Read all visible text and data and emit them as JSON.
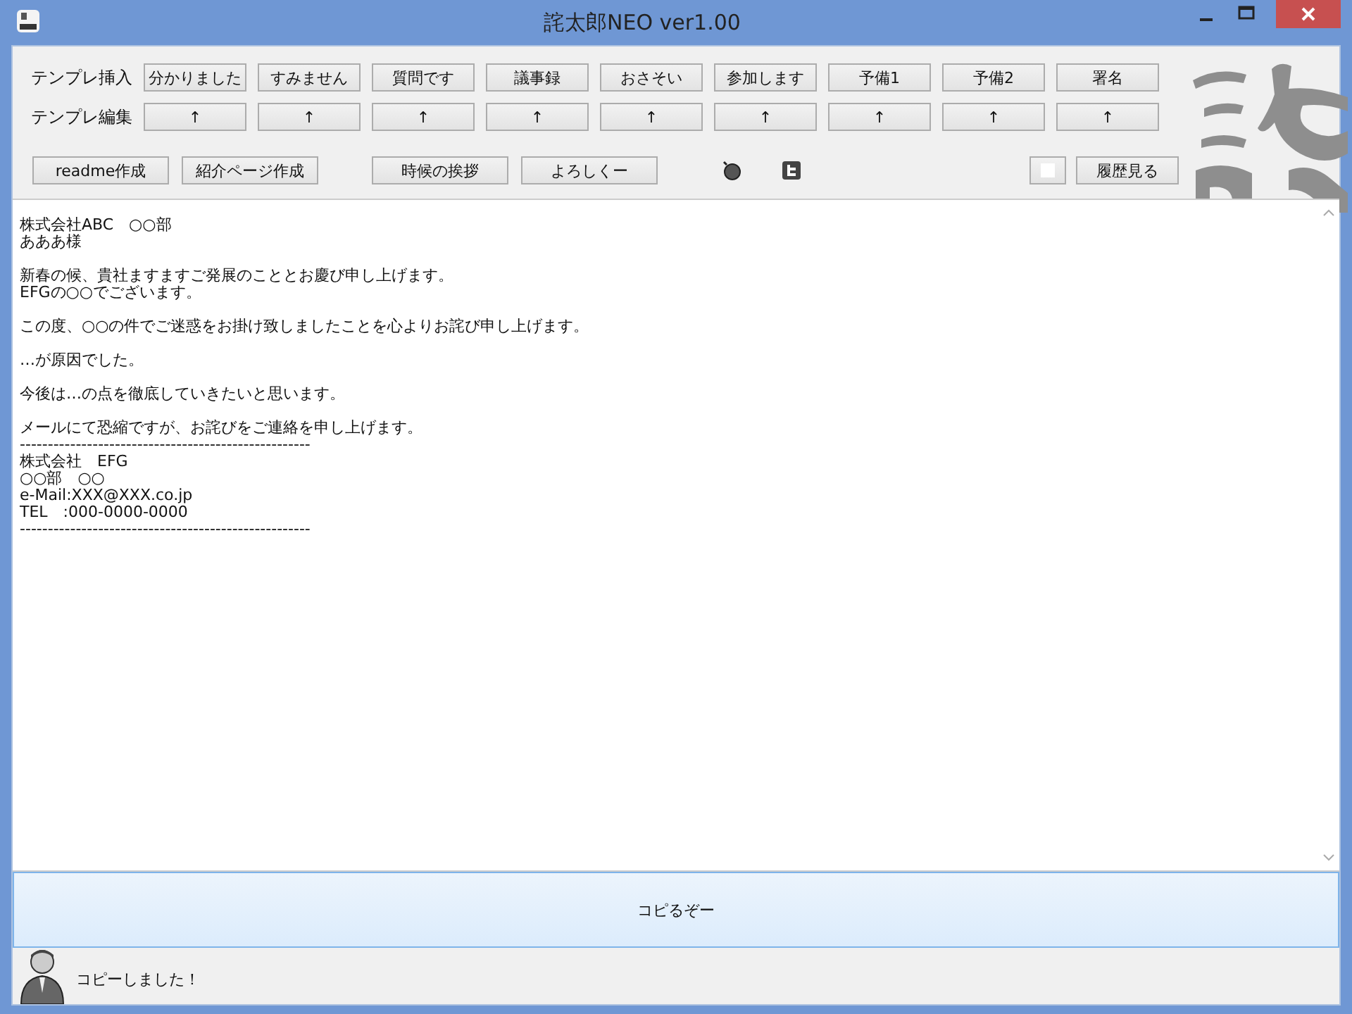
{
  "window": {
    "title": "詫太郎NEO  ver1.00"
  },
  "template_rows": [
    {
      "label": "テンプレ挿入",
      "buttons": [
        "分かりました",
        "すみません",
        "質問です",
        "議事録",
        "おさそい",
        "参加します",
        "予備1",
        "予備2",
        "署名"
      ]
    },
    {
      "label": "テンプレ編集",
      "buttons": [
        "↑",
        "↑",
        "↑",
        "↑",
        "↑",
        "↑",
        "↑",
        "↑",
        "↑"
      ]
    }
  ],
  "tools": {
    "left": [
      "readme作成",
      "紹介ページ作成"
    ],
    "middle": [
      "時候の挨拶",
      "よろしくー"
    ],
    "history": "履歴見る"
  },
  "editor": {
    "paragraphs": [
      [
        "株式会社ABC　○○部",
        "あああ様"
      ],
      [
        "新春の候、貴社ますますご発展のこととお慶び申し上げます。",
        "EFGの○○でございます。"
      ],
      [
        "この度、○○の件でご迷惑をお掛け致しましたことを心よりお詫び申し上げます。"
      ],
      [
        "…が原因でした。"
      ],
      [
        "今後は…の点を徹底していきたいと思います。"
      ],
      [
        "メールにて恐縮ですが、お詫びをご連絡を申し上げます。",
        "----------------------------------------------------",
        "株式会社　EFG",
        "○○部　○○",
        "e-Mail:XXX@XXX.co.jp",
        "TEL　:000-0000-0000",
        "----------------------------------------------------"
      ]
    ]
  },
  "copy_button": "コピるぞー",
  "status": "コピーしました！"
}
